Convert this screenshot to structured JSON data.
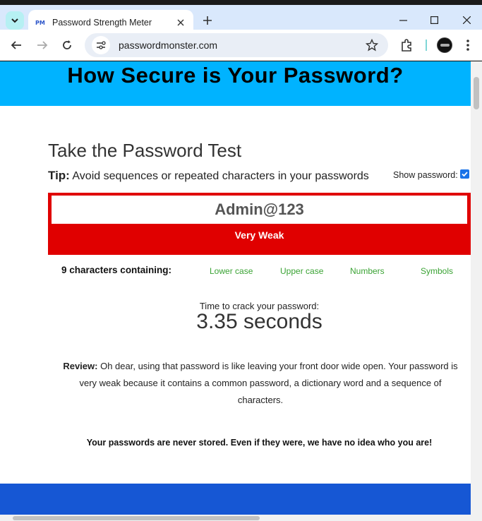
{
  "browser": {
    "tab_title": "Password Strength Meter",
    "tab_favicon_text": "PM",
    "url": "passwordmonster.com",
    "icons": [
      "tab-search-icon",
      "close-icon",
      "new-tab-icon",
      "minimize-icon",
      "maximize-icon",
      "window-close-icon",
      "back-icon",
      "forward-icon",
      "reload-icon",
      "site-info-icon",
      "bookmark-star-icon",
      "extensions-icon",
      "profile-avatar",
      "menu-icon"
    ]
  },
  "page": {
    "banner_title": "How Secure is Your Password?",
    "section_title": "Take the Password Test",
    "tip_label": "Tip:",
    "tip_text": "Avoid sequences or repeated characters in your passwords",
    "show_password_label": "Show password:",
    "show_password_checked": true,
    "password_value": "Admin@123",
    "strength_label": "Very Weak",
    "chars_summary": "9 characters containing:",
    "char_types": [
      "Lower case",
      "Upper case",
      "Numbers",
      "Symbols"
    ],
    "crack_label": "Time to crack your password:",
    "crack_time": "3.35 seconds",
    "review_label": "Review:",
    "review_text": "Oh dear, using that password is like leaving your front door wide open. Your password is very weak because it contains a common password, a dictionary word and a sequence of characters.",
    "privacy_notice": "Your passwords are never stored. Even if they were, we have no idea who you are!"
  },
  "colors": {
    "banner": "#00b3ff",
    "strength_bar": "#e00000",
    "char_type": "#3aa334",
    "footer": "#1657d4"
  }
}
